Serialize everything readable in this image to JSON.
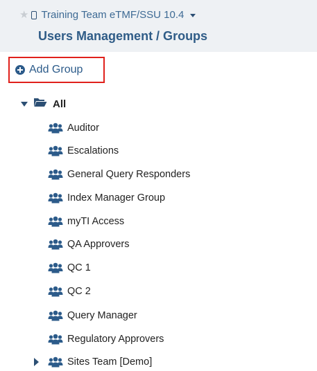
{
  "header": {
    "project_name": "Training Team eTMF/SSU 10.4",
    "page_title": "Users Management / Groups"
  },
  "toolbar": {
    "add_group_label": "Add Group"
  },
  "tree": {
    "root_label": "All",
    "items": [
      {
        "label": "Auditor"
      },
      {
        "label": "Escalations"
      },
      {
        "label": "General Query Responders"
      },
      {
        "label": "Index Manager Group"
      },
      {
        "label": "myTI Access"
      },
      {
        "label": "QA Approvers"
      },
      {
        "label": "QC 1"
      },
      {
        "label": "QC 2"
      },
      {
        "label": "Query Manager"
      },
      {
        "label": "Regulatory Approvers"
      },
      {
        "label": "Sites Team [Demo]"
      }
    ]
  },
  "colors": {
    "accent": "#2c5b8a",
    "header_bg": "#eef1f4",
    "highlight_border": "#e0201b"
  }
}
